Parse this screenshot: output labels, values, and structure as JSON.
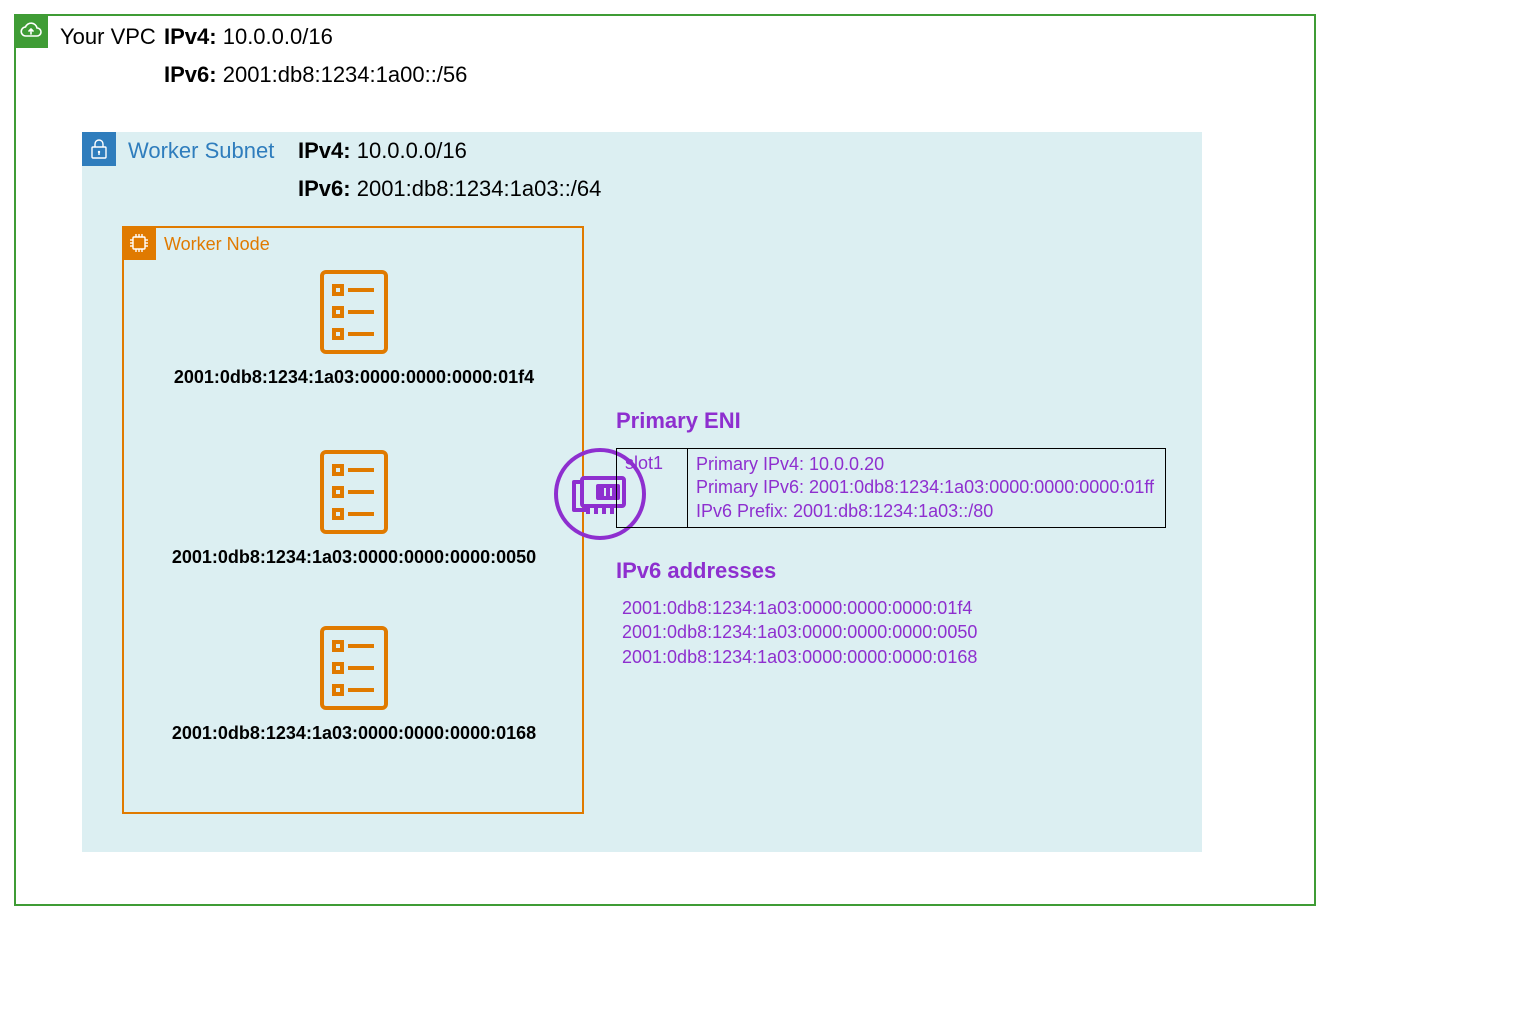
{
  "vpc": {
    "title": "Your VPC",
    "ipv4_label": "IPv4:",
    "ipv4_value": "10.0.0.0/16",
    "ipv6_label": "IPv6:",
    "ipv6_value": "2001:db8:1234:1a00::/56"
  },
  "subnet": {
    "title": "Worker Subnet",
    "ipv4_label": "IPv4:",
    "ipv4_value": "10.0.0.0/16",
    "ipv6_label": "IPv6:",
    "ipv6_value": "2001:db8:1234:1a03::/64"
  },
  "worker": {
    "title": "Worker Node",
    "pods": [
      "2001:0db8:1234:1a03:0000:0000:0000:01f4",
      "2001:0db8:1234:1a03:0000:0000:0000:0050",
      "2001:0db8:1234:1a03:0000:0000:0000:0168"
    ]
  },
  "eni": {
    "heading": "Primary ENI",
    "slot": "slot1",
    "primary_ipv4": "Primary IPv4: 10.0.0.20",
    "primary_ipv6": "Primary IPv6: 2001:0db8:1234:1a03:0000:0000:0000:01ff",
    "ipv6_prefix": "IPv6 Prefix: 2001:db8:1234:1a03::/80",
    "addresses_heading": "IPv6 addresses",
    "addresses": [
      "2001:0db8:1234:1a03:0000:0000:0000:01f4",
      "2001:0db8:1234:1a03:0000:0000:0000:0050",
      "2001:0db8:1234:1a03:0000:0000:0000:0168"
    ]
  }
}
